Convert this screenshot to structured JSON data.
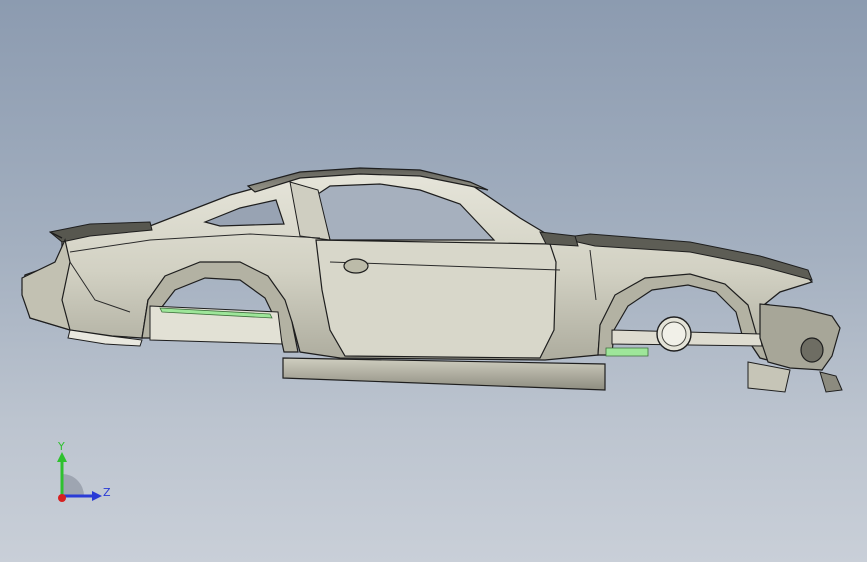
{
  "viewport": {
    "background_top": "#8c9bb0",
    "background_bottom": "#c9cfd8"
  },
  "model": {
    "body_color": "#d4d3c6",
    "edge_color": "#1e1e1e",
    "highlight_color": "#9ee69a",
    "shadow_color": "#6f6f66"
  },
  "triad": {
    "y_label": "Y",
    "z_label": "Z",
    "y_color": "#2fc12f",
    "z_color": "#2a3bd6",
    "x_color": "#d62020"
  }
}
